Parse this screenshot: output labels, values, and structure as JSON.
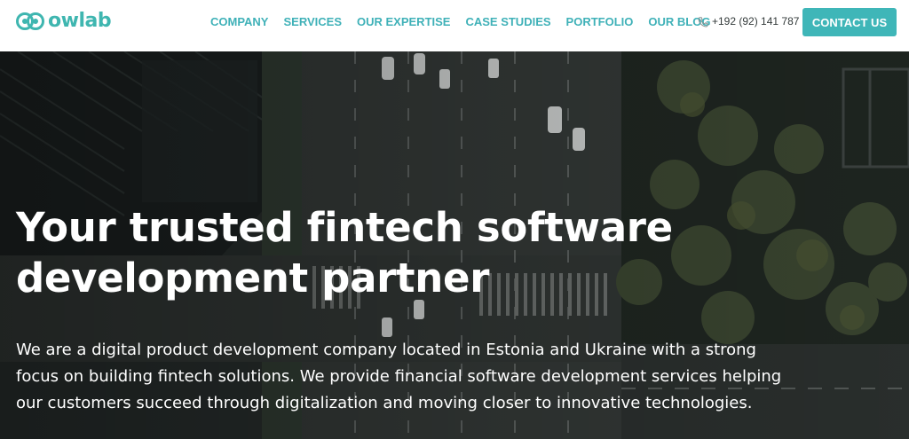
{
  "header": {
    "logo_text": "owlab",
    "nav": [
      "COMPANY",
      "SERVICES",
      "OUR EXPERTISE",
      "CASE STUDIES",
      "PORTFOLIO",
      "OUR BLOG"
    ],
    "phone": "+192 (92) 141 787",
    "cta_label": "CONTACT US"
  },
  "hero": {
    "headline_line1": "Your trusted fintech software",
    "headline_line2": "development partner",
    "intro_line1": "We are a digital product development company located in Estonia and Ukraine with a strong",
    "intro_line2": "focus on building fintech solutions. We provide financial software development services helping",
    "intro_line3": "our customers succeed through digitalization and moving closer to innovative technologies."
  },
  "colors": {
    "brand": "#3fb6b0",
    "nav_text": "#3fb1b8",
    "cta_bg": "#3fb6b8",
    "header_bg": "#ffffff",
    "hero_text": "#ffffff"
  },
  "icons": {
    "logo": "owl-eyes-icon",
    "phone": "phone-icon"
  }
}
